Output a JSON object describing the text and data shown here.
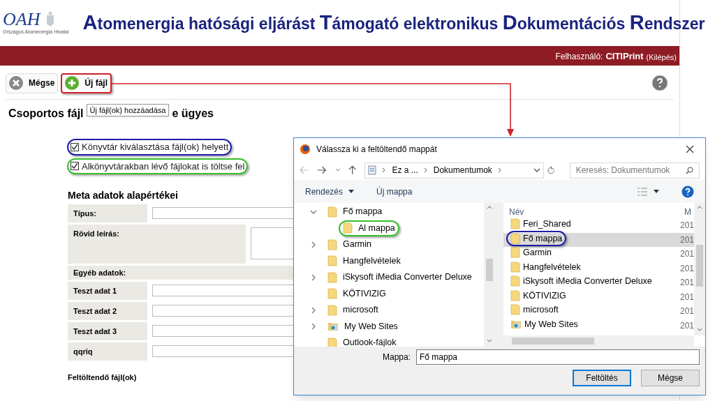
{
  "header": {
    "logo_mark": "OAH",
    "logo_caption": "Országos Atomenergia Hivatal",
    "title": "Atomenergia hatósági eljárást Támogató elektronikus Dokumentációs Rendszer"
  },
  "user_bar": {
    "label": "Felhasználó:",
    "user": "CITIPrint",
    "logout": "(Kilépés)"
  },
  "toolbar": {
    "buttons": [
      {
        "kind": "cancel",
        "label": "Mégse",
        "circled": false
      },
      {
        "kind": "add",
        "label": "Új fájl",
        "circled": true,
        "color": "#d0202a"
      }
    ]
  },
  "tooltip": "Új fájl(ok) hozzáadása",
  "heading": {
    "before": "Csoportos fájl",
    "after": "e ügyes"
  },
  "options": [
    {
      "label": "Könyvtár kiválasztása fájl(ok) helyett",
      "checked": true,
      "circled": true,
      "color": "#1c1ca8"
    },
    {
      "label": "Alkönyvtárakban lévő fájlokat is töltse fel",
      "checked": true,
      "circled": true,
      "color": "#33c02a"
    }
  ],
  "meta": {
    "title": "Meta adatok alapértékei",
    "rows": [
      {
        "kind": "input",
        "label": "Típus:"
      },
      {
        "kind": "textarea",
        "label": "Rövid leírás:"
      },
      {
        "kind": "section",
        "label": "Egyéb adatok:"
      },
      {
        "kind": "input",
        "label": "Teszt adat 1"
      },
      {
        "kind": "input",
        "label": "Teszt adat 2"
      },
      {
        "kind": "input",
        "label": "Teszt adat 3"
      },
      {
        "kind": "input",
        "label": "qqriq"
      }
    ]
  },
  "files_label": "Feltöltendő fájl(ok)",
  "dialog": {
    "title": "Válassza ki a feltöltendő mappát",
    "path": [
      "Ez a ...",
      "Dokumentumok"
    ],
    "search": {
      "placeholder": "Keresés: Dokumentumok"
    },
    "commands": [
      "Rendezés",
      "Új mappa"
    ],
    "tree": [
      {
        "name": "Fő mappa",
        "kind": "folder",
        "expanded": true,
        "circled": false,
        "children": [
          {
            "name": "Al mappa",
            "kind": "folder",
            "circled": true,
            "color": "#33c02a"
          }
        ]
      },
      {
        "name": "Garmin",
        "kind": "folder",
        "expanded": false,
        "circled": false
      },
      {
        "name": "Hangfelvételek",
        "kind": "folder",
        "circled": false
      },
      {
        "name": "iSkysoft iMedia Converter Deluxe",
        "kind": "folder",
        "expanded": false,
        "circled": false
      },
      {
        "name": "KÖTIVIZIG",
        "kind": "folder",
        "circled": false
      },
      {
        "name": "microsoft",
        "kind": "folder",
        "expanded": false,
        "circled": false
      },
      {
        "name": "My Web Sites",
        "kind": "web",
        "expanded": false,
        "circled": false
      },
      {
        "name": "Outlook-fájlok",
        "kind": "folder",
        "circled": false
      }
    ],
    "columns": [
      "Név",
      "M"
    ],
    "files": [
      {
        "name": "Feri_Shared",
        "date": "201",
        "kind": "folder",
        "selected": false,
        "circled": false
      },
      {
        "name": "Fő mappa",
        "date": "201",
        "kind": "folder",
        "selected": true,
        "circled": true,
        "color": "#1c1ca8"
      },
      {
        "name": "Garmin",
        "date": "201",
        "kind": "folder",
        "selected": false,
        "circled": false
      },
      {
        "name": "Hangfelvételek",
        "date": "201",
        "kind": "folder",
        "selected": false,
        "circled": false
      },
      {
        "name": "iSkysoft iMedia Converter Deluxe",
        "date": "201",
        "kind": "folder",
        "selected": false,
        "circled": false
      },
      {
        "name": "KÖTIVIZIG",
        "date": "201",
        "kind": "folder",
        "selected": false,
        "circled": false
      },
      {
        "name": "microsoft",
        "date": "201",
        "kind": "folder",
        "selected": false,
        "circled": false
      },
      {
        "name": "My Web Sites",
        "date": "201",
        "kind": "web",
        "selected": false,
        "circled": false
      }
    ],
    "folder_label": "Mappa:",
    "folder_value": "Fő mappa",
    "buttons": [
      {
        "label": "Feltöltés",
        "default": true
      },
      {
        "label": "Mégse",
        "default": false
      }
    ]
  }
}
